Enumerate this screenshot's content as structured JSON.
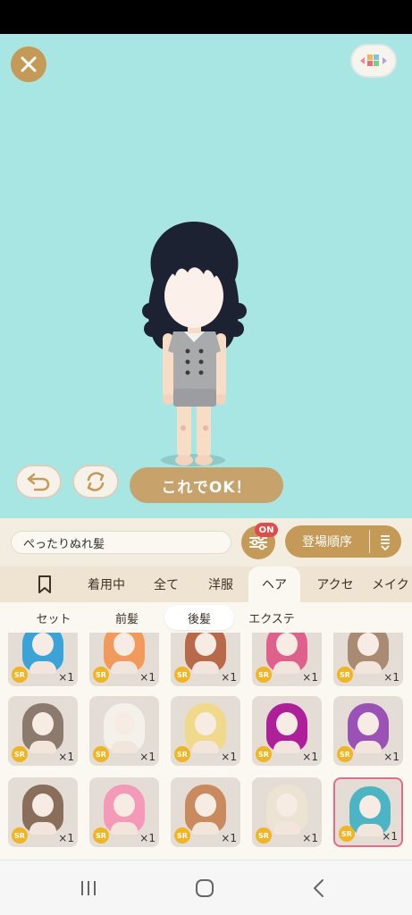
{
  "stage": {
    "background": "#a8e6e4",
    "ok_label": "これでOK！"
  },
  "search": {
    "value": "ぺったりぬれ髪"
  },
  "filter": {
    "badge": "ON"
  },
  "sort": {
    "label": "登場順序"
  },
  "tabs": [
    {
      "label": "着用中"
    },
    {
      "label": "全て"
    },
    {
      "label": "洋服"
    },
    {
      "label": "ヘア",
      "active": true
    },
    {
      "label": "アクセ"
    },
    {
      "label": "メイク"
    }
  ],
  "subtabs": [
    {
      "label": "セット"
    },
    {
      "label": "前髪"
    },
    {
      "label": "後髪",
      "active": true
    },
    {
      "label": "エクステ"
    }
  ],
  "items": [
    {
      "rarity": "SR",
      "count": "×1",
      "hair_color": "#3aa3d8"
    },
    {
      "rarity": "SR",
      "count": "×1",
      "hair_color": "#f29a5c"
    },
    {
      "rarity": "SR",
      "count": "×1",
      "hair_color": "#b8694a"
    },
    {
      "rarity": "SR",
      "count": "×1",
      "hair_color": "#e0608c"
    },
    {
      "rarity": "SR",
      "count": "×1",
      "hair_color": "#a88b72"
    },
    {
      "rarity": "SR",
      "count": "×1",
      "hair_color": "#8d7a6e"
    },
    {
      "rarity": "SR",
      "count": "×1",
      "hair_color": "#f4f1ea"
    },
    {
      "rarity": "SR",
      "count": "×1",
      "hair_color": "#f0d98a"
    },
    {
      "rarity": "SR",
      "count": "×1",
      "hair_color": "#b01f9a"
    },
    {
      "rarity": "SR",
      "count": "×1",
      "hair_color": "#9a52b6"
    },
    {
      "rarity": "SR",
      "count": "×1",
      "hair_color": "#8a6e5c"
    },
    {
      "rarity": "SR",
      "count": "×1",
      "hair_color": "#f49ab8"
    },
    {
      "rarity": "SR",
      "count": "×1",
      "hair_color": "#c98a5e"
    },
    {
      "rarity": "SR",
      "count": "×1",
      "hair_color": "#ece3d3"
    },
    {
      "rarity": "SR",
      "count": "×1",
      "hair_color": "#4bb5c4",
      "selected": true
    }
  ],
  "colors": {
    "gold": "#c49a56",
    "badge_red": "#e24b4b",
    "sr_badge": "#f2b521",
    "selected_border": "#e46b8d"
  },
  "icons": {
    "close": "close-icon",
    "menu": "color-blocks-icon",
    "undo": "undo-arrow-icon",
    "random": "refresh-icon",
    "filter": "sliders-icon",
    "sort_order": "sort-order-icon",
    "bookmark": "bookmark-icon",
    "nav_recent": "recent-apps-icon",
    "nav_home": "home-icon",
    "nav_back": "back-icon"
  }
}
